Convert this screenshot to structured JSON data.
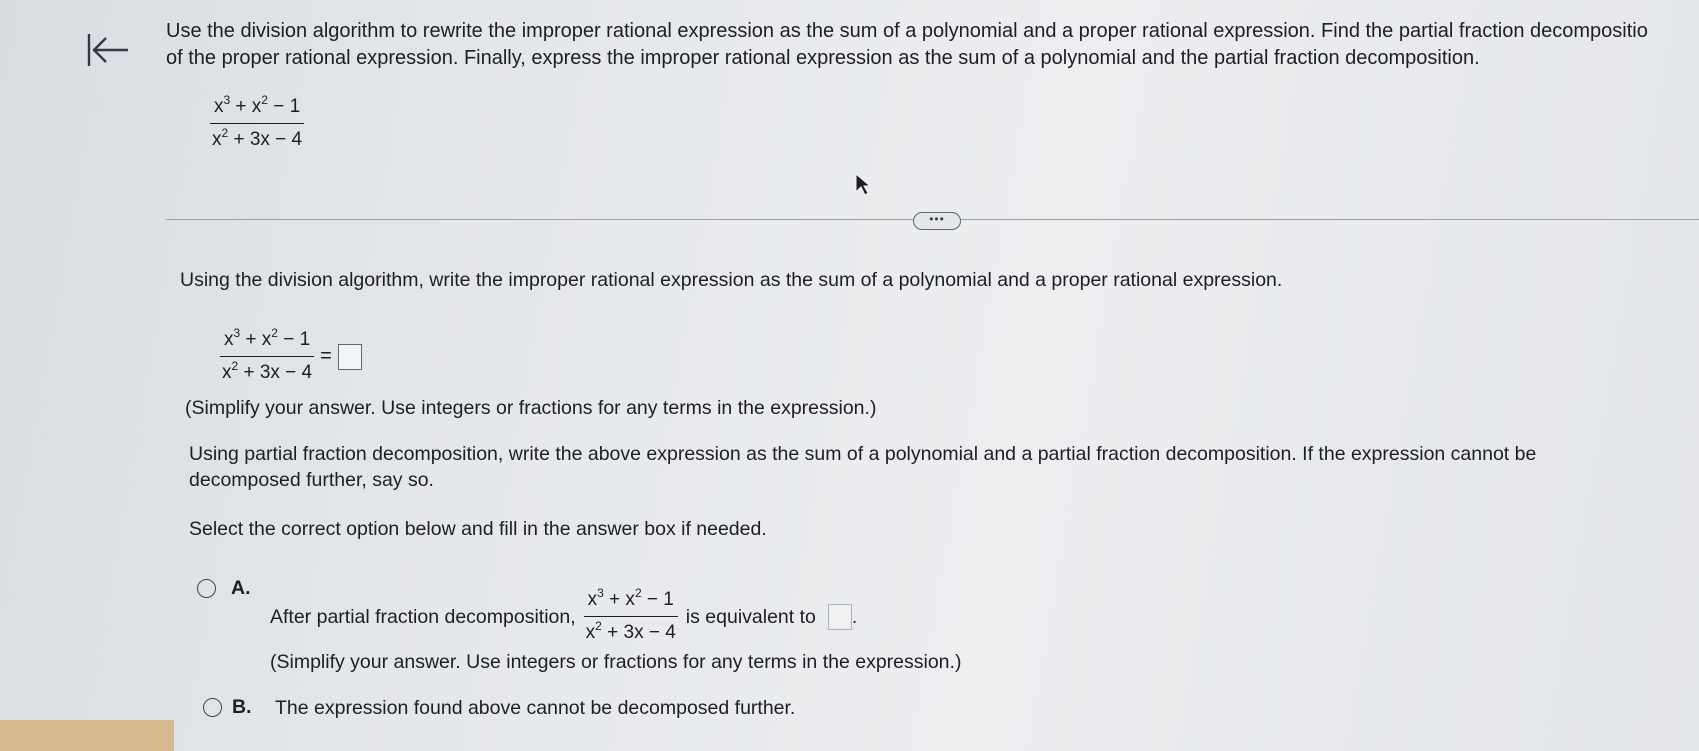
{
  "instructions": {
    "line1": "Use the division algorithm to rewrite the improper rational expression as the sum of a polynomial and a proper rational expression. Find the partial fraction decompositio",
    "line2": "of the proper rational expression. Finally, express the improper rational expression as the sum of a polynomial and the partial fraction decomposition."
  },
  "expression": {
    "num_x": "x",
    "num_exp1": "3",
    "num_mid": " + x",
    "num_exp2": "2",
    "num_tail": " − 1",
    "den_x": "x",
    "den_exp": "2",
    "den_tail": " + 3x − 4"
  },
  "more_button": "•••",
  "step1": {
    "prompt": "Using the division algorithm, write the improper rational expression as the sum of a polynomial and a proper rational expression.",
    "equals": "=",
    "hint": "(Simplify your answer. Use integers or fractions for any terms in the expression.)"
  },
  "step2": {
    "prompt_line1": "Using partial fraction decomposition, write the above expression as the sum of a polynomial and a partial fraction decomposition. If the expression cannot be",
    "prompt_line2": "decomposed further, say so.",
    "select_prompt": "Select the correct option below and fill in the answer box if needed."
  },
  "option_a": {
    "label": "A.",
    "text_before": "After partial fraction decomposition,",
    "text_after": "is equivalent to",
    "period": ".",
    "hint": "(Simplify your answer. Use integers or fractions for any terms in the expression.)"
  },
  "option_b": {
    "label": "B.",
    "text": "The expression found above cannot be decomposed further."
  },
  "icons": {
    "back": "back-to-start-icon",
    "cursor": "mouse-pointer-icon"
  }
}
